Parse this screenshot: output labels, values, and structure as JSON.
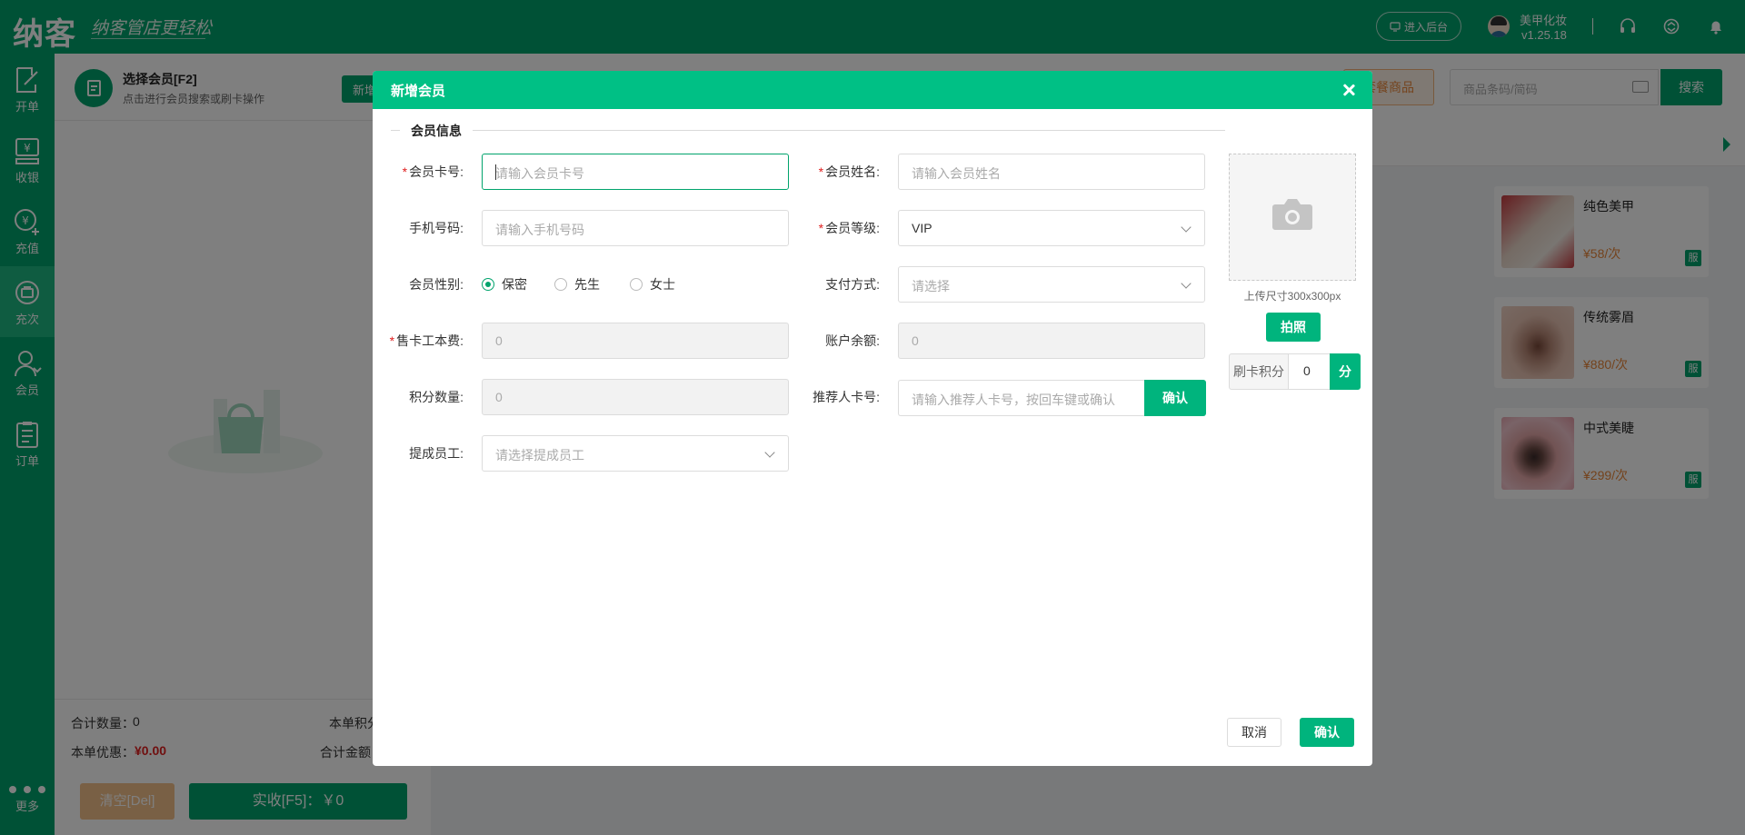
{
  "topbar": {
    "logo": "纳客",
    "slogan": "纳客管店更轻松",
    "backend_label": "进入后台",
    "shop_name": "美甲化妆",
    "version": "v1.25.18"
  },
  "sidebar": {
    "items": [
      {
        "label": "开单",
        "icon": "edit-doc-icon"
      },
      {
        "label": "收银",
        "icon": "cashier-icon"
      },
      {
        "label": "充值",
        "icon": "recharge-icon"
      },
      {
        "label": "充次",
        "icon": "recharge-times-icon"
      },
      {
        "label": "会员",
        "icon": "member-icon"
      },
      {
        "label": "订单",
        "icon": "order-icon"
      }
    ],
    "more_label": "更多"
  },
  "left_panel": {
    "select_member_title": "选择会员[F2]",
    "select_member_sub": "点击进行会员搜索或刷卡操作",
    "new_label": "新增",
    "total_qty_label": "合计数量：",
    "total_qty_value": "0",
    "order_points_label": "本单积分：",
    "discount_label": "本单优惠：",
    "discount_value": "¥0.00",
    "total_amount_label": "合计金额：",
    "clear_label": "清空[Del]",
    "pay_label": "实收[F5]：￥0"
  },
  "right_panel": {
    "package_label": "套餐商品",
    "search_placeholder": "商品条码/简码",
    "search_label": "搜索",
    "products": [
      {
        "name": "纯色美甲",
        "price": "¥58/次",
        "tag": "服"
      },
      {
        "name": "传统雾眉",
        "price": "¥880/次",
        "tag": "服"
      },
      {
        "name": "中式美睫",
        "price": "¥299/次",
        "tag": "服"
      }
    ],
    "partial_tags": [
      "服",
      "服",
      "服"
    ],
    "partial_name_fragment": "眉"
  },
  "modal": {
    "title": "新增会员",
    "section_title": "会员信息",
    "fields": {
      "card_no": {
        "label": "会员卡号:",
        "placeholder": "请输入会员卡号"
      },
      "name": {
        "label": "会员姓名:",
        "placeholder": "请输入会员姓名"
      },
      "phone": {
        "label": "手机号码:",
        "placeholder": "请输入手机号码"
      },
      "level": {
        "label": "会员等级:",
        "value": "VIP"
      },
      "gender": {
        "label": "会员性别:",
        "options": [
          "保密",
          "先生",
          "女士"
        ],
        "selected": "保密"
      },
      "pay_method": {
        "label": "支付方式:",
        "placeholder": "请选择"
      },
      "card_fee": {
        "label": "售卡工本费:",
        "value": "0"
      },
      "balance": {
        "label": "账户余额:",
        "value": "0"
      },
      "points": {
        "label": "积分数量:",
        "value": "0"
      },
      "referrer": {
        "label": "推荐人卡号:",
        "placeholder": "请输入推荐人卡号，按回车键或确认",
        "button": "确认"
      },
      "staff": {
        "label": "提成员工:",
        "placeholder": "请选择提成员工"
      }
    },
    "upload_tip": "上传尺寸300x300px",
    "photo_label": "拍照",
    "swipe_points_label": "刷卡积分",
    "swipe_points_value": "0",
    "swipe_points_unit": "分",
    "cancel_label": "取消",
    "confirm_label": "确认"
  },
  "colors": {
    "brand": "#00a36c",
    "modal_header": "#00c085",
    "price": "#e8873a",
    "required": "#e02020"
  }
}
